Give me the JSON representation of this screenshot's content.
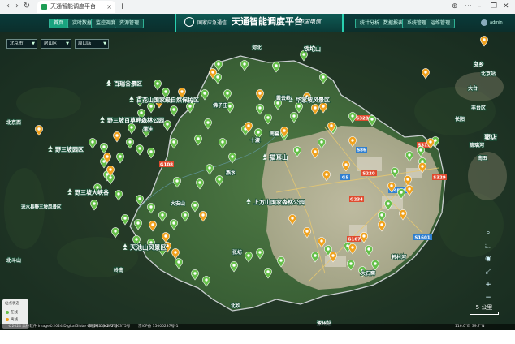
{
  "browser": {
    "tab_title": "天通智能调度平台",
    "tab_close": "×",
    "new_tab": "+",
    "controls": {
      "back": "‹",
      "forward": "›",
      "reload": "↻",
      "home": "⌂",
      "minimize": "–",
      "restore": "❐",
      "close": "✕",
      "globe": "⊕",
      "more": "⋯"
    }
  },
  "header": {
    "org_name": "国家应急通信",
    "title": "天通智能调度平台",
    "telecom": "中国电信",
    "nav_left": [
      "首页",
      "实时数据",
      "监控调度",
      "资源管理"
    ],
    "nav_right": [
      "统计分析",
      "数据报表",
      "系统管理",
      "运维管理"
    ],
    "user": "admin"
  },
  "filters": [
    {
      "value": "北京市"
    },
    {
      "value": "房山区"
    },
    {
      "value": "周口店"
    }
  ],
  "colors": {
    "station_green": "#66c04a",
    "station_orange": "#f0a21e",
    "boundary": "#c9ced0"
  },
  "map": {
    "places": [
      {
        "name": "百瑞谷景区"
      },
      {
        "name": "百花山国家级自然保护区"
      },
      {
        "name": "野三坡百草畔森林公园"
      },
      {
        "name": "野三坡园区"
      },
      {
        "name": "野三坡大峡谷"
      },
      {
        "name": "涞水县野三坡风景区"
      },
      {
        "name": "天池山风景区"
      },
      {
        "name": "上方山国家森林公园"
      },
      {
        "name": "猫耳山"
      },
      {
        "name": "华家坡风景区"
      },
      {
        "name": "铁坨山"
      },
      {
        "name": "霞云岭"
      },
      {
        "name": "佛子庄"
      },
      {
        "name": "南窖"
      },
      {
        "name": "燕水"
      },
      {
        "name": "蒲洼"
      },
      {
        "name": "十渡"
      },
      {
        "name": "张坊"
      },
      {
        "name": "大石窝"
      },
      {
        "name": "河北"
      },
      {
        "name": "大安山"
      },
      {
        "name": "韩村河"
      },
      {
        "name": "良乡"
      },
      {
        "name": "琉璃河"
      },
      {
        "name": "窦店"
      },
      {
        "name": "南五"
      },
      {
        "name": "长阳"
      },
      {
        "name": "北斗山"
      },
      {
        "name": "大台"
      },
      {
        "name": "北京站"
      },
      {
        "name": "丰台区"
      },
      {
        "name": "北京西"
      },
      {
        "name": "岭南"
      },
      {
        "name": "北坎"
      },
      {
        "name": "涿州站"
      }
    ],
    "roads": [
      "G5",
      "G4501",
      "G107",
      "G108",
      "G234",
      "S328",
      "S220",
      "S311",
      "S329",
      "S1601",
      "S86"
    ]
  },
  "legend": {
    "title": "站点状态",
    "items": [
      {
        "label": "在线"
      },
      {
        "label": "离线"
      }
    ]
  },
  "scale": {
    "label": "5 公里"
  },
  "tools": [
    "search-tool",
    "area-select-tool",
    "layer-tool",
    "fullscreen-tool",
    "zoom-in-tool",
    "zoom-out-tool"
  ],
  "footer": {
    "left": "©2024 高德软件 Image©2024 DigitalGlobe GS(2023)4277号",
    "center1": "审图号 GS(2021)6375号",
    "center2": "京ICP备 15000237号-1",
    "right": "116.0°E, 39.7°N"
  }
}
